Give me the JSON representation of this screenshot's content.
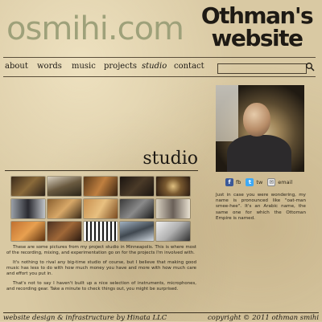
{
  "header": {
    "site_name": "osmihi.com",
    "logo_line1": "Othman's",
    "logo_line2": "website"
  },
  "nav": {
    "items": [
      {
        "label": "about",
        "current": false
      },
      {
        "label": "words",
        "current": false
      },
      {
        "label": "music",
        "current": false
      },
      {
        "label": "projects",
        "current": false
      },
      {
        "label": "studio",
        "current": true
      },
      {
        "label": "contact",
        "current": false
      }
    ],
    "search_value": ""
  },
  "main": {
    "title": "studio",
    "paragraphs": [
      "These are some pictures from my project studio in Minneapolis. This is where most of the recording, mixing, and experimentation go on for the projects I'm involved with.",
      "It's nothing to rival any big-time studio of course, but I believe that making good music has less to do with how much money you have and more with how much care and effort you put in.",
      "That's not to say I haven't built up a nice selection of instruments, microphones, and recording gear. Take a minute to check things out, you might be surprised."
    ]
  },
  "sidebar": {
    "social": [
      {
        "label": "fb",
        "icon": "facebook-icon",
        "color": "#3b5998"
      },
      {
        "label": "tw",
        "icon": "twitter-icon",
        "color": "#3fa9f5"
      },
      {
        "label": "email",
        "icon": "email-icon",
        "color": "#e8e8e8"
      }
    ],
    "about_text": "Just in case you were wondering, my name is pronounced like \"oat-man smee-hee\". It's an Arabic name, the same one for which the Ottoman Empire is named."
  },
  "footer": {
    "left": "website design & infrastructure by Hinata LLC",
    "right": "copyright © 2011 othman smihi"
  },
  "colors": {
    "logo_left": "#9ea17a",
    "text": "#2a2418",
    "background": "#d9c9a3"
  }
}
